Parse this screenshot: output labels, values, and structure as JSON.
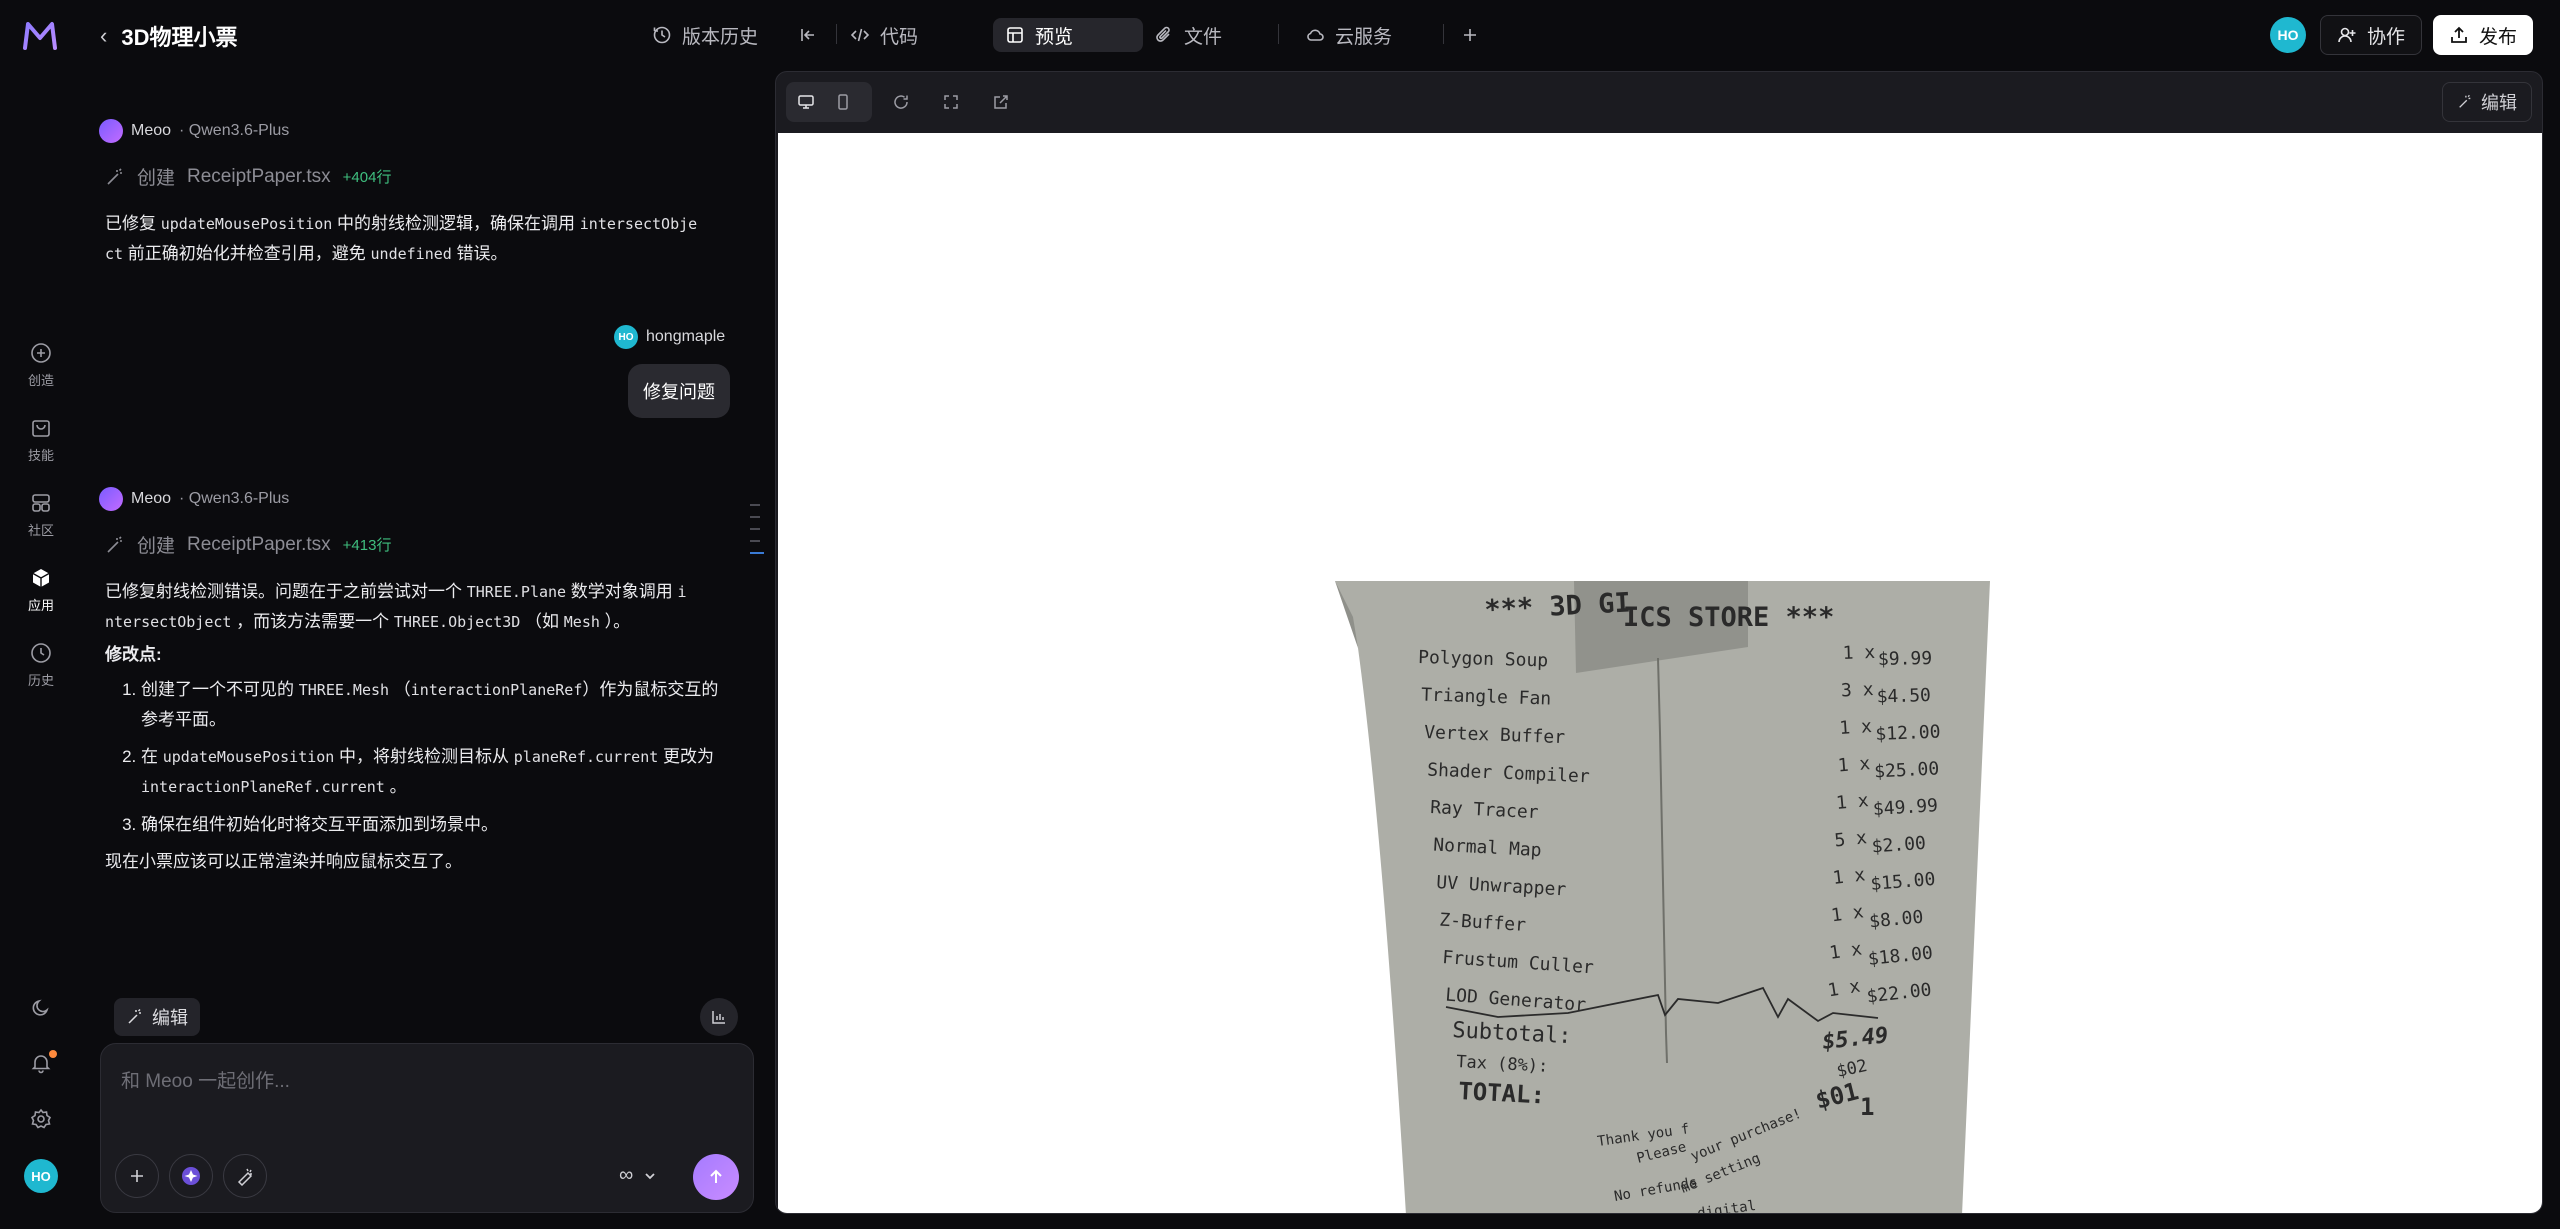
{
  "header": {
    "project_title": "3D物理小票",
    "version_history": "版本历史",
    "code": "代码",
    "preview": "预览",
    "files": "文件",
    "cloud": "云服务",
    "user_initials": "HO",
    "collaborate": "协作",
    "publish": "发布"
  },
  "nav": {
    "items": [
      {
        "label": "创造",
        "icon": "plus-circle-icon"
      },
      {
        "label": "技能",
        "icon": "bag-icon"
      },
      {
        "label": "社区",
        "icon": "grid-icon"
      },
      {
        "label": "应用",
        "icon": "cube-icon"
      },
      {
        "label": "历史",
        "icon": "clock-icon"
      }
    ],
    "user_initials": "HO"
  },
  "chat": {
    "msg1": {
      "author": "Meoo",
      "model": "· Qwen3.6-Plus",
      "action": "创建",
      "file": "ReceiptPaper.tsx",
      "lines": "+404行",
      "t1": "已修复 ",
      "c1": "updateMousePosition",
      "t2": " 中的射线检测逻辑，确保在调用 ",
      "c2": "intersectObje",
      "c2b": "ct",
      "t3": " 前正确初始化并检查引用，避免 ",
      "c3": "undefined",
      "t4": " 错误。"
    },
    "user": {
      "name": "hongmaple",
      "initials": "HO",
      "text": "修复问题"
    },
    "msg2": {
      "author": "Meoo",
      "model": "· Qwen3.6-Plus",
      "action": "创建",
      "file": "ReceiptPaper.tsx",
      "lines": "+413行",
      "p1a": "已修复射线检测错误。问题在于之前尝试对一个 ",
      "p1c1": "THREE.Plane",
      "p1b": " 数学对象调用 ",
      "p1c2a": "i",
      "p1c2b": "ntersectObject",
      "p1c": " ，而该方法需要一个 ",
      "p1c3": "THREE.Object3D",
      "p1d": " （如 ",
      "p1c4": "Mesh",
      "p1e": " ）。",
      "heading": "修改点:",
      "li1a": "创建了一个不可见的 ",
      "li1c1": "THREE.Mesh",
      "li1b": " （",
      "li1c2": "interactionPlaneRef",
      "li1c": "）作为鼠标交互的参考平面。",
      "li2a": "在 ",
      "li2c1": "updateMousePosition",
      "li2b": " 中，将射线检测目标从 ",
      "li2c2": "planeRef.current",
      "li2c": " 更改为 ",
      "li2c3": "interactionPlaneRef.current",
      "li2d": " 。",
      "li3": "确保在组件初始化时将交互平面添加到场景中。",
      "closing": "现在小票应该可以正常渲染并响应鼠标交互了。"
    }
  },
  "composer": {
    "edit_chip": "编辑",
    "placeholder": "和 Meoo 一起创作...",
    "mode": "∞"
  },
  "preview_toolbar": {
    "edit": "编辑"
  },
  "receipt": {
    "title_left": "*** 3D GI",
    "title_right": "ICS STORE ***",
    "items": [
      {
        "name": "Polygon Soup",
        "qty": "1 x",
        "price": "$9.99"
      },
      {
        "name": "Triangle Fan",
        "qty": "3 x",
        "price": "$4.50"
      },
      {
        "name": "Vertex Buffer",
        "qty": "1 x",
        "price": "$12.00"
      },
      {
        "name": "Shader Compiler",
        "qty": "1 x",
        "price": "$25.00"
      },
      {
        "name": "Ray Tracer",
        "qty": "1 x",
        "price": "$49.99"
      },
      {
        "name": "Normal Map",
        "qty": "5 x",
        "price": "$2.00"
      },
      {
        "name": "UV Unwrapper",
        "qty": "1 x",
        "price": "$15.00"
      },
      {
        "name": "Z-Buffer",
        "qty": "1 x",
        "price": "$8.00"
      },
      {
        "name": "Frustum Culler",
        "qty": "1 x",
        "price": "$18.00"
      },
      {
        "name": "LOD Generator",
        "qty": "1 x",
        "price": "$22.00"
      }
    ],
    "subtotal_label": "Subtotal:",
    "subtotal_value": "$5.49",
    "tax_label": "Tax (8%):",
    "tax_value": "$02",
    "total_label": "TOTAL:",
    "total_value": "$01",
    "total_cents": "1",
    "thanks": "Thank you f",
    "please": "Please",
    "your_purchase": "your purchase!",
    "no_refunds": "No refunds",
    "me_setting": "me setting",
    "digital": "digital"
  }
}
